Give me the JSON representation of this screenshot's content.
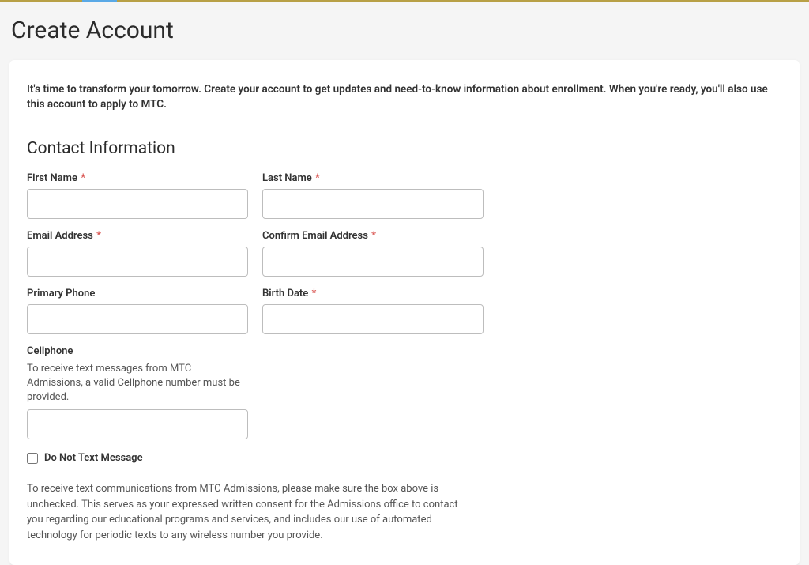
{
  "page": {
    "title": "Create Account"
  },
  "intro": "It's time to transform your tomorrow. Create your account to get updates and need-to-know information about enrollment. When you're ready, you'll also use this account to apply to MTC.",
  "section": {
    "title": "Contact Information"
  },
  "form": {
    "first_name": {
      "label": "First Name",
      "required": true,
      "value": ""
    },
    "last_name": {
      "label": "Last Name",
      "required": true,
      "value": ""
    },
    "email": {
      "label": "Email Address",
      "required": true,
      "value": ""
    },
    "confirm_email": {
      "label": "Confirm Email Address",
      "required": true,
      "value": ""
    },
    "primary_phone": {
      "label": "Primary Phone",
      "required": false,
      "value": ""
    },
    "birth_date": {
      "label": "Birth Date",
      "required": true,
      "value": ""
    },
    "cellphone": {
      "label": "Cellphone",
      "help": "To receive text messages from MTC Admissions, a valid Cellphone number must be provided.",
      "value": ""
    },
    "do_not_text": {
      "label": "Do Not Text Message",
      "checked": false
    }
  },
  "disclaimer": "To receive text communications from MTC Admissions, please make sure the box above is unchecked. This serves as your expressed written consent for the Admissions office to contact you regarding our educational programs and services, and includes our use of automated technology for periodic texts to any wireless number you provide.",
  "star": "*"
}
